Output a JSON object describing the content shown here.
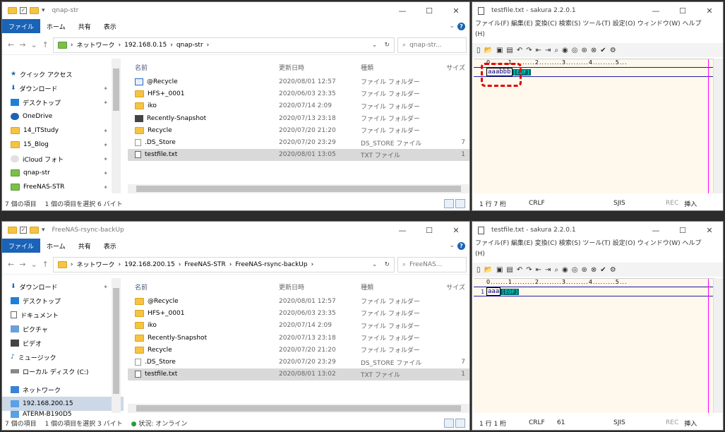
{
  "explorer_top": {
    "title": "qnap-str",
    "ribbon": {
      "file": "ファイル",
      "home": "ホーム",
      "share": "共有",
      "view": "表示"
    },
    "path": [
      "ネットワーク",
      "192.168.0.15",
      "qnap-str"
    ],
    "search_placeholder": "qnap-str...",
    "nav": [
      {
        "label": "クイック アクセス",
        "icon": "star-icon",
        "pin": false
      },
      {
        "label": "ダウンロード",
        "icon": "download-icon",
        "pin": true
      },
      {
        "label": "デスクトップ",
        "icon": "desktop-icon",
        "pin": true
      },
      {
        "label": "OneDrive",
        "icon": "cloud-icon",
        "pin": false
      },
      {
        "label": "14_ITStudy",
        "icon": "folder-icon",
        "pin": true
      },
      {
        "label": "15_Blog",
        "icon": "folder-icon",
        "pin": true
      },
      {
        "label": "iCloud フォト",
        "icon": "photos-icon",
        "pin": true
      },
      {
        "label": "qnap-str",
        "icon": "network-folder-icon",
        "pin": true
      },
      {
        "label": "FreeNAS-STR",
        "icon": "network-folder-icon",
        "pin": true
      }
    ],
    "columns": {
      "name": "名前",
      "date": "更新日時",
      "type": "種類",
      "size": "サイズ"
    },
    "rows": [
      {
        "name": "@Recycle",
        "date": "2020/08/01 12:57",
        "type": "ファイル フォルダー",
        "size": "",
        "icon": "recycle-folder-icon"
      },
      {
        "name": "HFS+_0001",
        "date": "2020/06/03 23:35",
        "type": "ファイル フォルダー",
        "size": "",
        "icon": "folder-icon"
      },
      {
        "name": "iko",
        "date": "2020/07/14 2:09",
        "type": "ファイル フォルダー",
        "size": "",
        "icon": "folder-icon"
      },
      {
        "name": "Recently-Snapshot",
        "date": "2020/07/13 23:18",
        "type": "ファイル フォルダー",
        "size": "",
        "icon": "snapshot-folder-icon"
      },
      {
        "name": "Recycle",
        "date": "2020/07/20 21:20",
        "type": "ファイル フォルダー",
        "size": "",
        "icon": "folder-icon"
      },
      {
        "name": ".DS_Store",
        "date": "2020/07/20 23:29",
        "type": "DS_STORE ファイル",
        "size": "7",
        "icon": "file-icon"
      },
      {
        "name": "testfile.txt",
        "date": "2020/08/01 13:05",
        "type": "TXT ファイル",
        "size": "1",
        "icon": "text-file-icon",
        "selected": true
      }
    ],
    "status": {
      "count": "7 個の項目",
      "selected": "1 個の項目を選択 6 バイト",
      "online": ""
    }
  },
  "explorer_bottom": {
    "title": "FreeNAS-rsync-backUp",
    "ribbon": {
      "file": "ファイル",
      "home": "ホーム",
      "share": "共有",
      "view": "表示"
    },
    "path": [
      "ネットワーク",
      "192.168.200.15",
      "FreeNAS-STR",
      "FreeNAS-rsync-backUp"
    ],
    "search_placeholder": "FreeNAS...",
    "nav": [
      {
        "label": "ダウンロード",
        "icon": "download-icon",
        "pin": true
      },
      {
        "label": "デスクトップ",
        "icon": "desktop-icon",
        "pin": false
      },
      {
        "label": "ドキュメント",
        "icon": "document-icon",
        "pin": false
      },
      {
        "label": "ピクチャ",
        "icon": "pictures-icon",
        "pin": false
      },
      {
        "label": "ビデオ",
        "icon": "video-icon",
        "pin": false
      },
      {
        "label": "ミュージック",
        "icon": "music-icon",
        "pin": false
      },
      {
        "label": "ローカル ディスク (C:)",
        "icon": "disk-icon",
        "pin": false
      },
      {
        "label": "ネットワーク",
        "icon": "network-icon",
        "pin": false
      },
      {
        "label": "192.168.200.15",
        "icon": "computer-icon",
        "pin": false,
        "selected": true
      },
      {
        "label": "ATERM-B190D5",
        "icon": "computer-icon",
        "pin": false
      }
    ],
    "columns": {
      "name": "名前",
      "date": "更新日時",
      "type": "種類",
      "size": "サイズ"
    },
    "rows": [
      {
        "name": "@Recycle",
        "date": "2020/08/01 12:57",
        "type": "ファイル フォルダー",
        "size": "",
        "icon": "folder-icon"
      },
      {
        "name": "HFS+_0001",
        "date": "2020/06/03 23:35",
        "type": "ファイル フォルダー",
        "size": "",
        "icon": "folder-icon"
      },
      {
        "name": "iko",
        "date": "2020/07/14 2:09",
        "type": "ファイル フォルダー",
        "size": "",
        "icon": "folder-icon"
      },
      {
        "name": "Recently-Snapshot",
        "date": "2020/07/13 23:18",
        "type": "ファイル フォルダー",
        "size": "",
        "icon": "folder-icon"
      },
      {
        "name": "Recycle",
        "date": "2020/07/20 21:20",
        "type": "ファイル フォルダー",
        "size": "",
        "icon": "folder-icon"
      },
      {
        "name": ".DS_Store",
        "date": "2020/07/20 23:29",
        "type": "DS_STORE ファイル",
        "size": "7",
        "icon": "file-icon"
      },
      {
        "name": "testfile.txt",
        "date": "2020/08/01 13:02",
        "type": "TXT ファイル",
        "size": "1",
        "icon": "text-file-icon",
        "selected": true
      }
    ],
    "status": {
      "count": "7 個の項目",
      "selected": "1 個の項目を選択 3 バイト",
      "online": "状況: オンライン"
    }
  },
  "sakura_top": {
    "title": "testfile.txt - sakura 2.2.0.1",
    "menu": "ファイル(F)  編集(E)  変換(C)  検索(S)  ツール(T)  設定(O)  ウィンドウ(W)  ヘルプ(H)",
    "ruler": "0.......1.........2.........3.........4.........5...",
    "line_number": "",
    "text": "aaabbb",
    "eof": "[EOF]",
    "status": {
      "pos": "1 行  7 桁",
      "eol": "CRLF",
      "code": "",
      "enc": "SJIS",
      "rec": "REC",
      "ins": "挿入"
    }
  },
  "sakura_bottom": {
    "title": "testfile.txt - sakura 2.2.0.1",
    "menu": "ファイル(F)  編集(E)  変換(C)  検索(S)  ツール(T)  設定(O)  ウィンドウ(W)  ヘルプ(H)",
    "ruler": "0.......1.........2.........3.........4.........5...",
    "line_number": "1",
    "text": "aaa",
    "eof": "[EOF]",
    "status": {
      "pos": "1 行  1 桁",
      "eol": "CRLF",
      "code": "61",
      "enc": "SJIS",
      "rec": "REC",
      "ins": "挿入"
    }
  },
  "colors": {
    "ribbon_blue": "#1a63b6",
    "highlight_red": "#e00000",
    "editor_bg": "#fff8ec"
  }
}
